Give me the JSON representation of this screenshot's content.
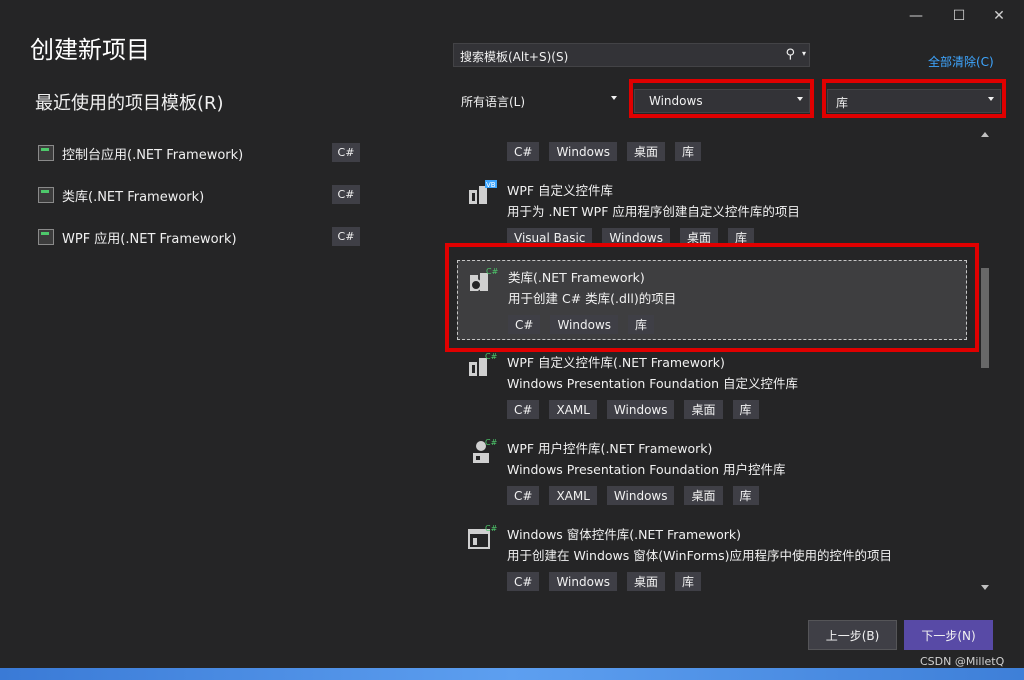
{
  "window": {
    "controls": {
      "minimize": "—",
      "maximize": "☐",
      "close": "✕"
    }
  },
  "title": "创建新项目",
  "recent": {
    "heading": "最近使用的项目模板(R)",
    "items": [
      {
        "label": "控制台应用(.NET Framework)",
        "lang": "C#"
      },
      {
        "label": "类库(.NET Framework)",
        "lang": "C#"
      },
      {
        "label": "WPF 应用(.NET Framework)",
        "lang": "C#"
      }
    ]
  },
  "search": {
    "placeholder": "搜索模板(Alt+S)(S)",
    "icon": "search-icon"
  },
  "clear_all": "全部清除(C)",
  "filters": {
    "language": "所有语言(L)",
    "platform": "Windows",
    "project_type": "库"
  },
  "templates": [
    {
      "name": "",
      "desc": "",
      "tags": [
        "C#",
        "Windows",
        "桌面",
        "库"
      ]
    },
    {
      "name": "WPF 自定义控件库",
      "desc": "用于为 .NET WPF 应用程序创建自定义控件库的项目",
      "tags": [
        "Visual Basic",
        "Windows",
        "桌面",
        "库"
      ],
      "badge": "VB"
    },
    {
      "name": "类库(.NET Framework)",
      "desc": "用于创建 C# 类库(.dll)的项目",
      "tags": [
        "C#",
        "Windows",
        "库"
      ],
      "badge": "C#"
    },
    {
      "name": "WPF 自定义控件库(.NET Framework)",
      "desc": "Windows Presentation Foundation 自定义控件库",
      "tags": [
        "C#",
        "XAML",
        "Windows",
        "桌面",
        "库"
      ],
      "badge": "C#"
    },
    {
      "name": "WPF 用户控件库(.NET Framework)",
      "desc": "Windows Presentation Foundation 用户控件库",
      "tags": [
        "C#",
        "XAML",
        "Windows",
        "桌面",
        "库"
      ],
      "badge": "C#"
    },
    {
      "name": "Windows 窗体控件库(.NET Framework)",
      "desc": "用于创建在 Windows 窗体(WinForms)应用程序中使用的控件的项目",
      "tags": [
        "C#",
        "Windows",
        "桌面",
        "库"
      ],
      "badge": "C#"
    }
  ],
  "buttons": {
    "back": "上一步(B)",
    "next": "下一步(N)"
  },
  "watermark": "CSDN @MilletQ",
  "colors": {
    "background": "#252526",
    "accent": "#584aa6",
    "highlight": "#e00000",
    "link": "#3ea6ff"
  }
}
